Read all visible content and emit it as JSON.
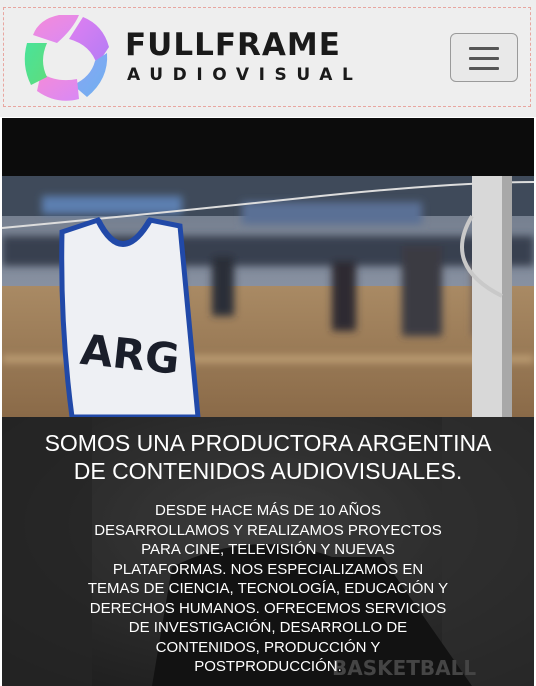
{
  "brand": {
    "name": "FULLFRAME",
    "tagline": "AUDIOVISUAL",
    "logo_icon": "camera-aperture-logo",
    "colors": {
      "pink": "#f08ae8",
      "purple": "#c07cf4",
      "blue": "#7fa6f2",
      "green": "#4fe08d",
      "dark": "#1a1a1a"
    }
  },
  "nav": {
    "menu_icon": "hamburger-menu-icon"
  },
  "hero": {
    "photo_icon": "basketball-jersey-photo"
  },
  "intro": {
    "headline": [
      "SOMOS UNA PRODUCTORA ARGENTINA",
      "DE CONTENIDOS AUDIOVISUALES."
    ],
    "description": [
      "DESDE HACE MÁS DE 10 AÑOS",
      "DESARROLLAMOS Y REALIZAMOS PROYECTOS",
      "PARA CINE, TELEVISIÓN Y NUEVAS",
      "PLATAFORMAS. NOS ESPECIALIZAMOS EN",
      "TEMAS DE CIENCIA, TECNOLOGÍA, EDUCACIÓN Y",
      "DERECHOS HUMANOS. OFRECEMOS SERVICIOS",
      "DE INVESTIGACIÓN, DESARROLLO DE",
      "CONTENIDOS, PRODUCCIÓN Y",
      "POSTPRODUCCIÓN."
    ]
  }
}
